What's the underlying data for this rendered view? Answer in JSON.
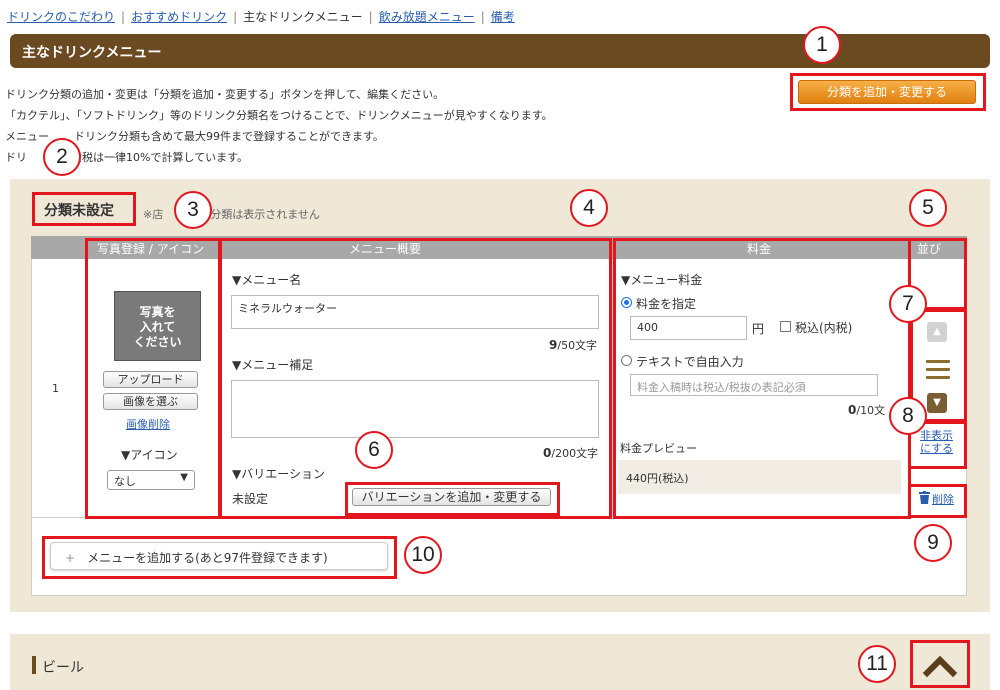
{
  "nav": {
    "items": [
      "ドリンクのこだわり",
      "おすすめドリンク",
      "主なドリンクメニュー",
      "飲み放題メニュー",
      "備考"
    ],
    "separator": "|"
  },
  "header": {
    "title": "主なドリンクメニュー"
  },
  "description": {
    "line1": "ドリンク分類の追加・変更は「分類を追加・変更する」ボタンを押して、編集ください。",
    "line2": "「カクテル」、「ソフトドリンク」等のドリンク分類名をつけることで、ドリンクメニューが見やすくなります。",
    "line3": "メニューは、ドリンク分類も含めて最大99件まで登録することができます。",
    "line4a": "ドリ",
    "line4b": "費税は一律10%で計算しています。",
    "line3a": "メニュー",
    "line3b": "、ドリンク分類も含めて最大99件まで登録することができます。"
  },
  "add_category_label": "分類を追加・変更する",
  "category": {
    "title": "分類未設定",
    "note_prefix": "※店",
    "note_suffix": "は分類は表示されません"
  },
  "table": {
    "headers": {
      "photo": "写真登録 / アイコン",
      "overview": "メニュー概要",
      "price": "料金",
      "order": "並び"
    },
    "row_number": "1"
  },
  "photo": {
    "placeholder": "写真を\n入れて\nください",
    "upload": "アップロード",
    "choose": "画像を選ぶ",
    "delete": "画像削除",
    "icon_label": "▼アイコン",
    "icon_value": "なし"
  },
  "overview": {
    "name_label": "▼メニュー名",
    "name_value": "ミネラルウォーター",
    "name_count": "9",
    "name_max": "/50文字",
    "supplement_label": "▼メニュー補足",
    "supplement_count": "0",
    "supplement_max": "/200文字",
    "variation_label": "▼バリエーション",
    "variation_status": "未設定",
    "variation_button": "バリエーションを追加・変更する"
  },
  "price": {
    "label": "▼メニュー料金",
    "option_specify": "料金を指定",
    "value": "400",
    "unit": "円",
    "tax_included": "税込(内税)",
    "option_text": "テキストで自由入力",
    "text_placeholder": "料金入稿時は税込/税抜の表記必須",
    "text_count": "0",
    "text_max": "/10文",
    "preview_label": "料金プレビュー",
    "preview_value": "440円(税込)"
  },
  "order": {
    "hide_link_line1": "非表示",
    "hide_link_line2": "にする",
    "delete": "削除"
  },
  "add_menu": {
    "plus": "+",
    "label": "メニューを追加する(あと97件登録できます)"
  },
  "next_category": {
    "title": "ビール"
  },
  "callouts": [
    "1",
    "2",
    "3",
    "4",
    "5",
    "6",
    "7",
    "8",
    "9",
    "10",
    "11"
  ],
  "colors": {
    "header": "#6b4a22",
    "accent": "#e07f10",
    "annotation": "#e3161e",
    "panel_bg": "#efe8d6",
    "link": "#2a5db0"
  }
}
